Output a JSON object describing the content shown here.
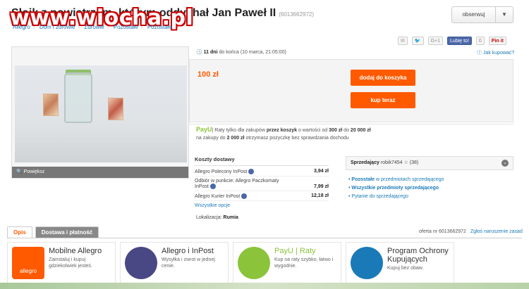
{
  "header": {
    "title": "Słoik z powietrzem, którym oddychał Jan Paweł II",
    "offer_id": "(6013662972)",
    "watermark": "www.wiocha.pl",
    "observe_label": "obserwuj",
    "breadcrumb": [
      "Allegro",
      "Dom i zdrowie",
      "Zdrowie",
      "Pozostałe",
      "Pozostałe"
    ]
  },
  "gallery": {
    "zoom_label": "Powiększ"
  },
  "share": {
    "gplus": "G+1",
    "like": "Lubię to!",
    "like_count": "0",
    "pinit": "Pin it"
  },
  "offer": {
    "end_days": "11 dni",
    "end_text": "do końca (10 marca, 21:05:00)",
    "report_link": "Jak kupować?",
    "price": "100 zł",
    "add_to_cart": "dodaj do koszyka",
    "buy_now": "kup teraz"
  },
  "payu": {
    "brand": "PayU",
    "line1_a": "| Raty tylko dla zakupów ",
    "line1_b": "przez koszyk",
    "line1_c": " o wartości od ",
    "line1_d": "300 zł",
    "line1_e": " do ",
    "line1_f": "20 000 zł",
    "line2_a": "na zakupy do ",
    "line2_b": "2 000 zł",
    "line2_c": " otrzymasz pożyczkę bez sprawdzania dochodu"
  },
  "shipping": {
    "title": "Koszty dostawy",
    "rows": [
      {
        "name": "Allegro Polecony InPost",
        "price": "3,94 zł"
      },
      {
        "name": "Odbiór w punkcie: Allegro Paczkomaty InPost",
        "price": "7,99 zł"
      },
      {
        "name": "Allegro Kurier InPost",
        "price": "12,18 zł"
      }
    ],
    "all_options": "Wszystkie opcje",
    "location_label": "Lokalizacja:",
    "location": "Rumia"
  },
  "seller": {
    "label": "Sprzedający",
    "name": "robik7454",
    "rating": "(38)",
    "links": [
      {
        "bold": "Pozostałe",
        "rest": " w przedmiotach sprzedającego"
      },
      {
        "bold": "Wszystkie przedmioty sprzedającego",
        "rest": ""
      },
      {
        "bold": "",
        "rest": "Pytanie do sprzedającego"
      }
    ]
  },
  "tabs": {
    "description": "Opis",
    "delivery": "Dostawa i płatność"
  },
  "offer_number": {
    "label": "oferta nr 6013662972",
    "report": "Zgłoś naruszenie zasad"
  },
  "promos": [
    {
      "title": "Mobilne Allegro",
      "text": "Zainstaluj i kupuj gdziekolwiek jesteś.",
      "logo_text": "allegro"
    },
    {
      "title": "Allegro i InPost",
      "text": "Wysyłka i zwrot w jednej cenie."
    },
    {
      "title": "PayU | Raty",
      "text": "Kup na raty szybko, łatwo i wygodnie."
    },
    {
      "title": "Program Ochrony Kupujących",
      "text": "Kupuj bez obaw."
    }
  ],
  "colors": {
    "accent": "#ff5a00",
    "link": "#1a7ab8",
    "payu": "#8bc33a"
  }
}
